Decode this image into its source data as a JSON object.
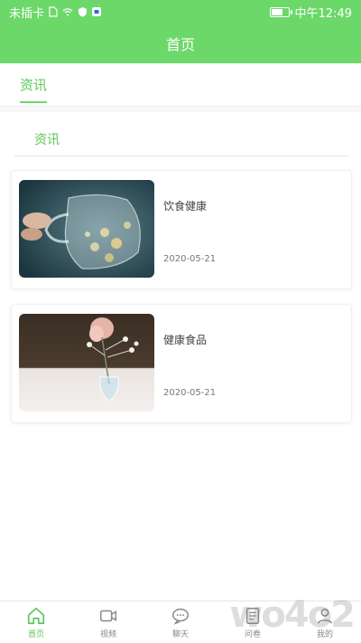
{
  "status_bar": {
    "carrier": "未插卡",
    "time": "中午12:49"
  },
  "header": {
    "title": "首页"
  },
  "tabs": [
    {
      "label": "资讯"
    }
  ],
  "section": {
    "title": "资讯"
  },
  "articles": [
    {
      "title": "饮食健康",
      "date": "2020-05-21",
      "image": "glass-teapot-photo"
    },
    {
      "title": "健康食品",
      "date": "2020-05-21",
      "image": "flower-vase-photo"
    }
  ],
  "bottom_nav": [
    {
      "label": "首页",
      "icon": "home-icon",
      "active": true
    },
    {
      "label": "视频",
      "icon": "video-icon",
      "active": false
    },
    {
      "label": "聊天",
      "icon": "chat-icon",
      "active": false
    },
    {
      "label": "问卷",
      "icon": "survey-icon",
      "active": false
    },
    {
      "label": "我的",
      "icon": "profile-icon",
      "active": false
    }
  ],
  "colors": {
    "accent": "#6cd86a",
    "accent_text": "#5cc65a"
  },
  "watermark": "wo4o2"
}
